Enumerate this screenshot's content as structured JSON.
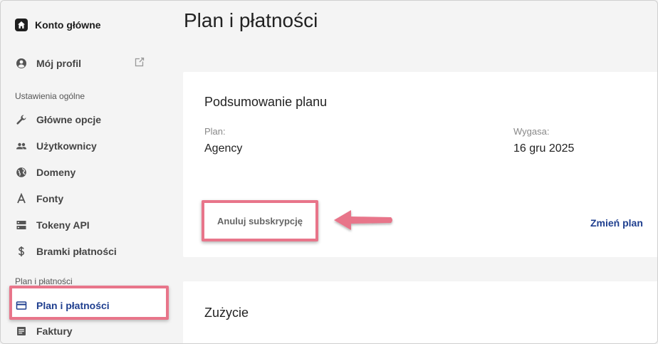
{
  "sidebar": {
    "account_label": "Konto główne",
    "profile_label": "Mój profil",
    "section_general": "Ustawienia ogólne",
    "items": [
      {
        "label": "Główne opcje",
        "icon": "wrench-icon"
      },
      {
        "label": "Użytkownicy",
        "icon": "users-icon"
      },
      {
        "label": "Domeny",
        "icon": "globe-icon"
      },
      {
        "label": "Fonty",
        "icon": "font-icon"
      },
      {
        "label": "Tokeny API",
        "icon": "server-icon"
      },
      {
        "label": "Bramki płatności",
        "icon": "dollar-icon"
      }
    ],
    "section_plan": "Plan i płatności",
    "plan_items": [
      {
        "label": "Plan i płatności",
        "icon": "credit-card-icon",
        "active": true
      },
      {
        "label": "Faktury",
        "icon": "document-icon"
      }
    ]
  },
  "main": {
    "title": "Plan i płatności",
    "summary": {
      "title": "Podsumowanie planu",
      "plan_label": "Plan:",
      "plan_value": "Agency",
      "expires_label": "Wygasa:",
      "expires_value": "16 gru 2025",
      "cancel_label": "Anuluj subskrypcję",
      "change_label": "Zmień plan"
    },
    "usage": {
      "title": "Zużycie"
    }
  },
  "colors": {
    "accent": "#1f3f8f",
    "highlight": "#e8758a",
    "background": "#f4f4f4"
  }
}
